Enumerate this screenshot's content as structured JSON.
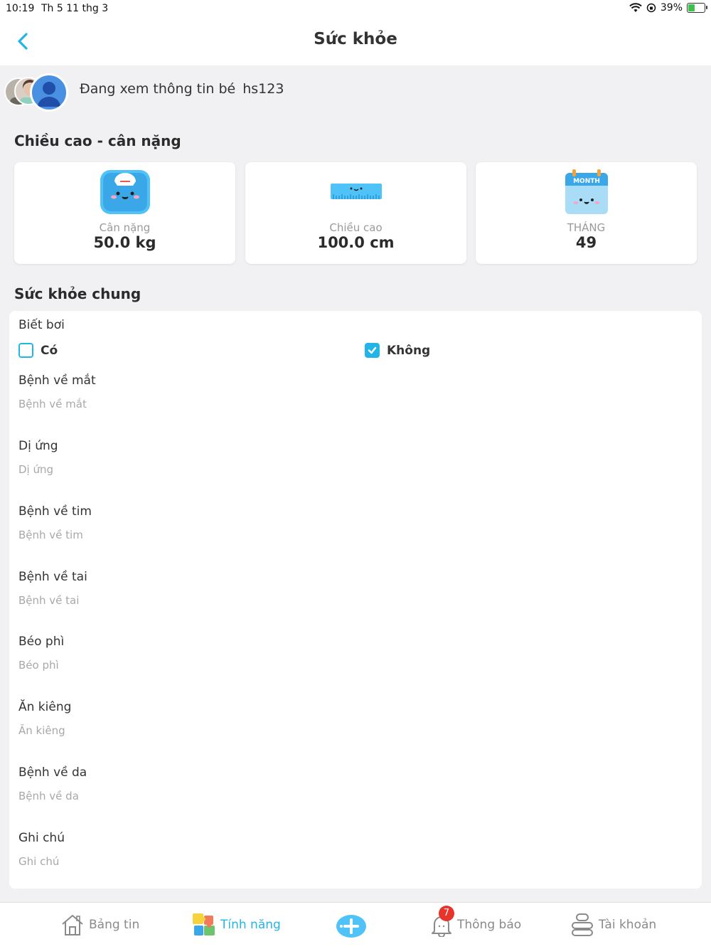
{
  "status_bar": {
    "time": "10:19",
    "date": "Th 5 11 thg 3",
    "battery": "39%",
    "battery_level": 0.39
  },
  "header": {
    "title": "Sức khỏe"
  },
  "viewing": {
    "prefix": "Đang xem thông tin bé",
    "student": "hs123"
  },
  "growth": {
    "title": "Chiều cao - cân nặng",
    "cards": [
      {
        "label": "Cân nặng",
        "value": "50.0 kg",
        "icon": "scale-icon"
      },
      {
        "label": "Chiều cao",
        "value": "100.0 cm",
        "icon": "ruler-icon"
      },
      {
        "label": "THÁNG",
        "value": "49",
        "icon": "calendar-icon",
        "icon_text": "MONTH"
      }
    ]
  },
  "health": {
    "title": "Sức khỏe chung",
    "swim": {
      "label": "Biết bơi",
      "yes": "Có",
      "no": "Không",
      "selected": "Không"
    },
    "fields": [
      {
        "label": "Bệnh về mắt",
        "placeholder": "Bệnh về mắt"
      },
      {
        "label": "Dị ứng",
        "placeholder": "Dị ứng"
      },
      {
        "label": "Bệnh về tim",
        "placeholder": "Bệnh về tim"
      },
      {
        "label": "Bệnh về tai",
        "placeholder": "Bệnh về tai"
      },
      {
        "label": "Béo phì",
        "placeholder": "Béo phì"
      },
      {
        "label": "Ăn kiêng",
        "placeholder": "Ăn kiêng"
      },
      {
        "label": "Bệnh về da",
        "placeholder": "Bệnh về da"
      },
      {
        "label": "Ghi chú",
        "placeholder": "Ghi chú"
      }
    ]
  },
  "nav": {
    "items": [
      {
        "label": "Bảng tin",
        "icon": "house-icon"
      },
      {
        "label": "Tính năng",
        "icon": "puzzle-icon",
        "active": true
      },
      {
        "label": "",
        "icon": "plus-icon"
      },
      {
        "label": "Thông báo",
        "icon": "bell-icon",
        "badge": "7"
      },
      {
        "label": "Tài khoản",
        "icon": "account-icon"
      }
    ]
  },
  "colors": {
    "accent": "#24b5e8",
    "badge": "#e8352b",
    "background": "#f1f1f3"
  }
}
